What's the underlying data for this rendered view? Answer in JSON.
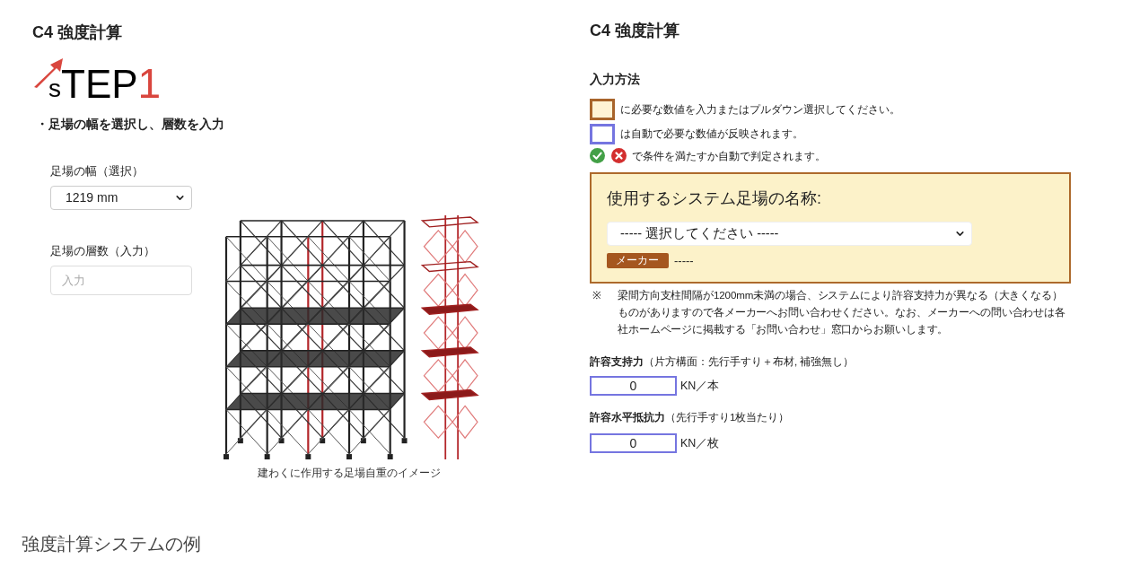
{
  "left_panel": {
    "title": "C4 強度計算",
    "step_logo": {
      "small_letter": "s",
      "letters": "TEP",
      "number": "1"
    },
    "instruction": "・足場の幅を選択し、層数を入力",
    "width_field": {
      "label": "足場の幅（選択）",
      "value": "1219 mm"
    },
    "levels_field": {
      "label": "足場の層数（入力）",
      "placeholder": "入力"
    },
    "figure": {
      "caption": "建わくに作用する足場自重のイメージ"
    }
  },
  "right_panel": {
    "title": "C4 強度計算",
    "input_method": {
      "heading": "入力方法",
      "legend": [
        {
          "kind": "input-swatch",
          "text": "に必要な数値を入力またはプルダウン選択してください。"
        },
        {
          "kind": "auto-swatch",
          "text": "は自動で必要な数値が反映されます。"
        },
        {
          "kind": "judgement-icons",
          "text": "で条件を満たすか自動で判定されます。"
        }
      ]
    },
    "system_card": {
      "title": "使用するシステム足場の名称:",
      "select_value": "----- 選択してください -----",
      "maker_label": "メーカー",
      "maker_value": "-----"
    },
    "note": {
      "mark": "※",
      "text": "梁間方向支柱間隔が1200mm未満の場合、システムにより許容支持力が異なる（大きくなる）ものがありますので各メーカーへお問い合わせください。なお、メーカーへの問い合わせは各社ホームページに掲載する「お問い合わせ」窓口からお願いします。"
    },
    "results": [
      {
        "label": "**許容支持力**（片方構面：先行手すり＋布材, 補強無し）",
        "value": "0",
        "unit": "KN／本"
      },
      {
        "label": "**許容水平抵抗力**（先行手すり1枚当たり）",
        "value": "0",
        "unit": "KN／枚"
      }
    ]
  },
  "caption": "強度計算システムの例"
}
